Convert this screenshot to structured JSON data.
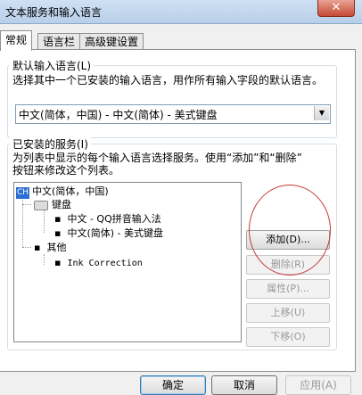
{
  "window": {
    "title": "文本服务和输入语言",
    "close_label": "✕"
  },
  "tabs": [
    {
      "label": "常规"
    },
    {
      "label": "语言栏"
    },
    {
      "label": "高级键设置"
    }
  ],
  "default_language": {
    "group_label": "默认输入语言(L)",
    "description": "选择其中一个已安装的输入语言，用作所有输入字段的默认语言。",
    "selected": "中文(简体，中国) - 中文(简体) - 美式键盘"
  },
  "installed_services": {
    "group_label": "已安装的服务(I)",
    "description_line1": "为列表中显示的每个输入语言选择服务。使用“添加”和“删除”",
    "description_line2": "按钮来修改这个列表。",
    "tree": {
      "language_badge": "CH",
      "language": "中文(简体，中国)",
      "keyboard_label": "键盘",
      "keyboard_items": [
        "中文 - QQ拼音输入法",
        "中文(简体) - 美式键盘"
      ],
      "other_label": "其他",
      "other_items": [
        "Ink Correction"
      ]
    },
    "buttons": {
      "add": "添加(D)...",
      "remove": "删除(R)",
      "properties": "属性(P)...",
      "move_up": "上移(U)",
      "move_down": "下移(O)"
    }
  },
  "footer": {
    "ok": "确定",
    "cancel": "取消",
    "apply": "应用(A)"
  }
}
